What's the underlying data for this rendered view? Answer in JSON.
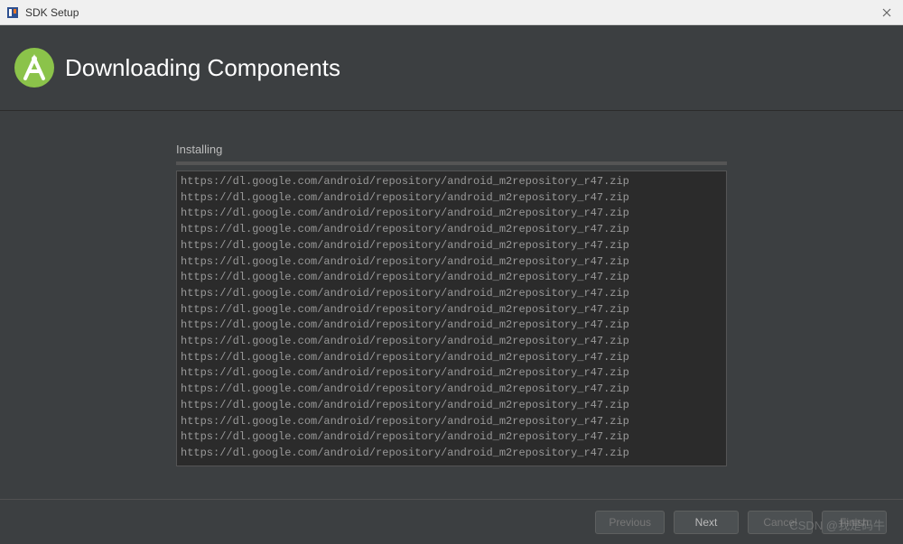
{
  "window": {
    "title": "SDK Setup"
  },
  "header": {
    "title": "Downloading Components"
  },
  "content": {
    "section_label": "Installing",
    "log_lines": [
      "https://dl.google.com/android/repository/android_m2repository_r47.zip",
      "https://dl.google.com/android/repository/android_m2repository_r47.zip",
      "https://dl.google.com/android/repository/android_m2repository_r47.zip",
      "https://dl.google.com/android/repository/android_m2repository_r47.zip",
      "https://dl.google.com/android/repository/android_m2repository_r47.zip",
      "https://dl.google.com/android/repository/android_m2repository_r47.zip",
      "https://dl.google.com/android/repository/android_m2repository_r47.zip",
      "https://dl.google.com/android/repository/android_m2repository_r47.zip",
      "https://dl.google.com/android/repository/android_m2repository_r47.zip",
      "https://dl.google.com/android/repository/android_m2repository_r47.zip",
      "https://dl.google.com/android/repository/android_m2repository_r47.zip",
      "https://dl.google.com/android/repository/android_m2repository_r47.zip",
      "https://dl.google.com/android/repository/android_m2repository_r47.zip",
      "https://dl.google.com/android/repository/android_m2repository_r47.zip",
      "https://dl.google.com/android/repository/android_m2repository_r47.zip",
      "https://dl.google.com/android/repository/android_m2repository_r47.zip",
      "https://dl.google.com/android/repository/android_m2repository_r47.zip",
      "https://dl.google.com/android/repository/android_m2repository_r47.zip"
    ]
  },
  "footer": {
    "previous": "Previous",
    "next": "Next",
    "cancel": "Cancel",
    "finish": "Finish"
  },
  "watermark": "CSDN @我是码牛"
}
